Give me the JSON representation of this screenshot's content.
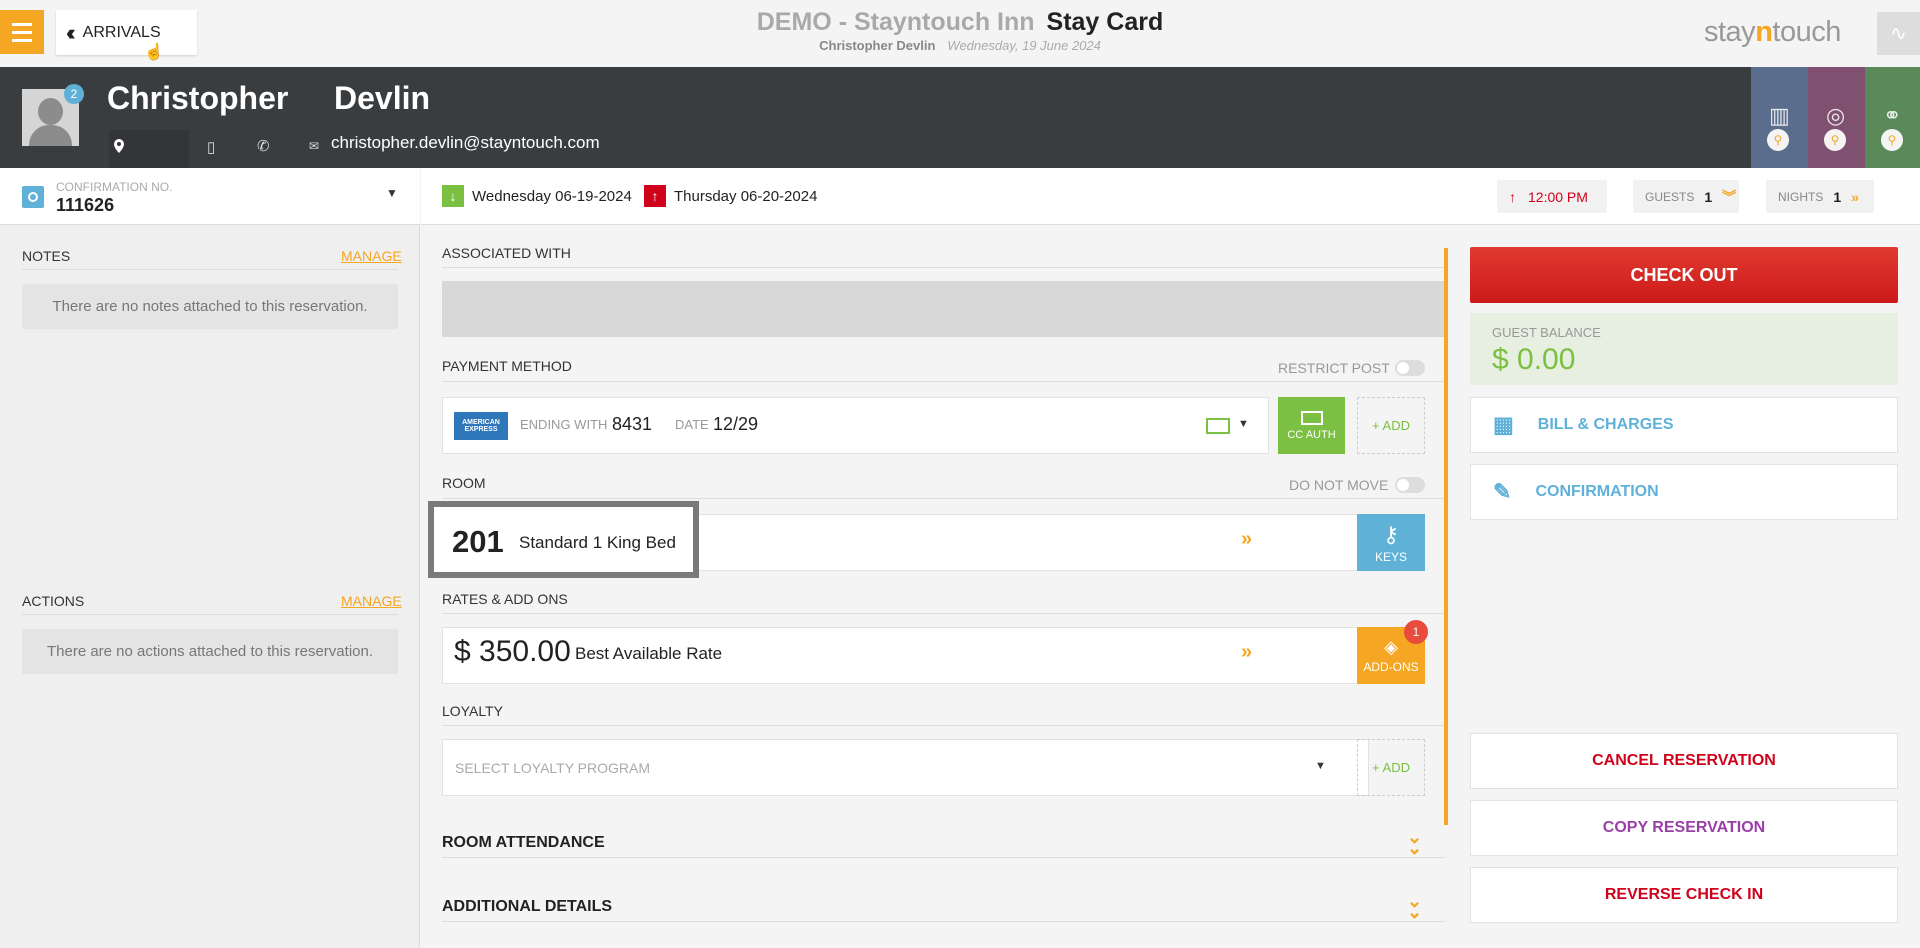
{
  "topbar": {
    "back_label": "ARRIVALS",
    "hotel_name": "DEMO - Stayntouch Inn",
    "page_title": "Stay Card",
    "guest_name": "Christopher Devlin",
    "date": "Wednesday, 19 June 2024",
    "brand_prefix": "stay",
    "brand_n": "n",
    "brand_suffix": "touch"
  },
  "guest": {
    "first_name": "Christopher",
    "last_name": "Devlin",
    "email": "christopher.devlin@stayntouch.com",
    "badge_count": "2"
  },
  "confirmation": {
    "label": "CONFIRMATION NO.",
    "number": "111626"
  },
  "notes": {
    "title": "NOTES",
    "manage": "MANAGE",
    "empty": "There are no notes attached to this reservation."
  },
  "actions": {
    "title": "ACTIONS",
    "manage": "MANAGE",
    "empty": "There are no actions attached to this reservation."
  },
  "dates": {
    "arrival": "Wednesday 06-19-2024",
    "departure": "Thursday 06-20-2024",
    "checkout_time": "12:00 PM",
    "guests_label": "GUESTS",
    "guests": "1",
    "nights_label": "NIGHTS",
    "nights": "1"
  },
  "associated": {
    "label": "ASSOCIATED WITH"
  },
  "payment": {
    "label": "PAYMENT METHOD",
    "restrict_label": "RESTRICT POST",
    "card_brand": "AMERICAN EXPRESS",
    "ending_label": "ENDING WITH",
    "ending": "8431",
    "date_label": "DATE",
    "date": "12/29",
    "cc_auth": "CC AUTH",
    "add": "+ ADD"
  },
  "room": {
    "label": "ROOM",
    "do_not_move": "DO NOT MOVE",
    "number": "201",
    "type": "Standard 1 King Bed",
    "keys": "KEYS"
  },
  "rates": {
    "label": "RATES & ADD ONS",
    "amount": "$ 350.00",
    "name": "Best Available Rate",
    "addons": "ADD-ONS",
    "addon_count": "1"
  },
  "loyalty": {
    "label": "LOYALTY",
    "placeholder": "SELECT LOYALTY PROGRAM",
    "add": "+ ADD"
  },
  "sections": {
    "room_attendance": "ROOM ATTENDANCE",
    "additional_details": "ADDITIONAL DETAILS"
  },
  "right": {
    "check_out": "CHECK OUT",
    "balance_label": "GUEST BALANCE",
    "balance": "$ 0.00",
    "bill": "BILL & CHARGES",
    "confirmation": "CONFIRMATION",
    "cancel": "CANCEL RESERVATION",
    "copy": "COPY RESERVATION",
    "reverse": "REVERSE CHECK IN"
  },
  "colors": {
    "accent": "#f5a623",
    "green": "#7bc043",
    "red": "#d0021b",
    "blue": "#5fb1d8",
    "purple": "#9b3fa8"
  }
}
